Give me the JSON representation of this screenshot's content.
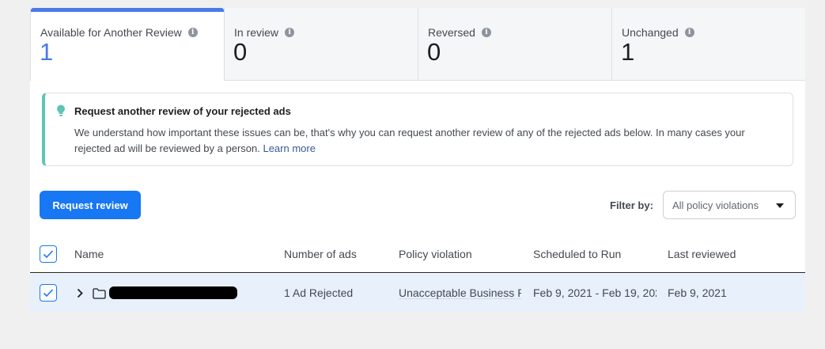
{
  "tabs": [
    {
      "label": "Available for Another Review",
      "count": "1",
      "active": true
    },
    {
      "label": "In review",
      "count": "0",
      "active": false
    },
    {
      "label": "Reversed",
      "count": "0",
      "active": false
    },
    {
      "label": "Unchanged",
      "count": "1",
      "active": false
    }
  ],
  "notice": {
    "title": "Request another review of your rejected ads",
    "body": "We understand how important these issues can be, that's why you can request another review of any of the rejected ads below. In many cases your rejected ad will be reviewed by a person. ",
    "link": "Learn more",
    "accent_color": "#5fc4b5"
  },
  "actions": {
    "request_review_label": "Request review",
    "filter_label": "Filter by:",
    "filter_value": "All policy violations"
  },
  "table": {
    "headers": {
      "name": "Name",
      "ads": "Number of ads",
      "violation": "Policy violation",
      "scheduled": "Scheduled to Run",
      "reviewed": "Last reviewed"
    },
    "rows": [
      {
        "ads": "1 Ad Rejected",
        "violation": "Unacceptable Business P",
        "scheduled": "Feb 9, 2021 - Feb 19, 202",
        "reviewed": "Feb 9, 2021"
      }
    ]
  },
  "colors": {
    "primary": "#1877f2",
    "active_tab": "#4a7ae8",
    "row_selected": "#e7f0fb"
  }
}
